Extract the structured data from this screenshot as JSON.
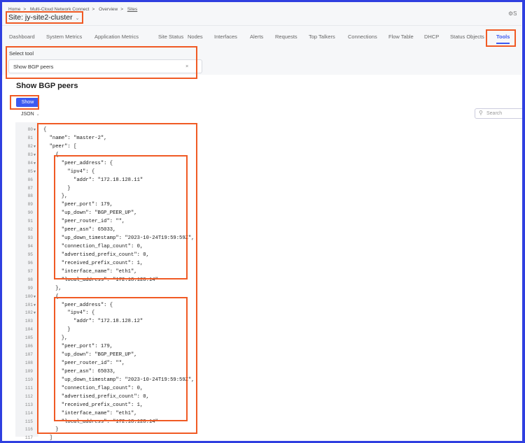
{
  "breadcrumb": [
    "Home",
    "Multi-Cloud Network Connect",
    "Overview",
    "Sites"
  ],
  "site_title": "Site: jy-site2-cluster",
  "header_right": "S",
  "tabs": [
    "Dashboard",
    "System Metrics",
    "Application Metrics",
    "Site Status",
    "Nodes",
    "Interfaces",
    "Alerts",
    "Requests",
    "Top Talkers",
    "Connections",
    "Flow Table",
    "DHCP",
    "Status Objects",
    "Tools"
  ],
  "active_tab": "Tools",
  "select_tool": {
    "label": "Select tool",
    "value": "Show BGP peers"
  },
  "section_title": "Show BGP peers",
  "show_button": "Show",
  "format_select": "JSON",
  "search_placeholder": "Search",
  "colors": {
    "accent": "#3d5af1",
    "highlight": "#f05a24",
    "frame": "#2f3fe0"
  },
  "code_lines": [
    {
      "n": 80,
      "fold": true,
      "i": 0,
      "t": "{"
    },
    {
      "n": 81,
      "i": 1,
      "t": "\"name\": \"master-2\","
    },
    {
      "n": 82,
      "fold": true,
      "i": 1,
      "t": "\"peer\": ["
    },
    {
      "n": 83,
      "fold": true,
      "i": 2,
      "t": "{"
    },
    {
      "n": 84,
      "fold": true,
      "i": 3,
      "t": "\"peer_address\": {"
    },
    {
      "n": 85,
      "fold": true,
      "i": 4,
      "t": "\"ipv4\": {"
    },
    {
      "n": 86,
      "i": 5,
      "t": "\"addr\": \"172.18.128.11\""
    },
    {
      "n": 87,
      "i": 4,
      "t": "}"
    },
    {
      "n": 88,
      "i": 3,
      "t": "},"
    },
    {
      "n": 89,
      "i": 3,
      "t": "\"peer_port\": 179,"
    },
    {
      "n": 90,
      "i": 3,
      "t": "\"up_down\": \"BGP_PEER_UP\","
    },
    {
      "n": 91,
      "i": 3,
      "t": "\"peer_router_id\": \"\","
    },
    {
      "n": 92,
      "i": 3,
      "t": "\"peer_asn\": 65033,"
    },
    {
      "n": 93,
      "i": 3,
      "t": "\"up_down_timestamp\": \"2023-10-24T19:59:59Z\","
    },
    {
      "n": 94,
      "i": 3,
      "t": "\"connection_flap_count\": 0,"
    },
    {
      "n": 95,
      "i": 3,
      "t": "\"advertised_prefix_count\": 0,"
    },
    {
      "n": 96,
      "i": 3,
      "t": "\"received_prefix_count\": 1,"
    },
    {
      "n": 97,
      "i": 3,
      "t": "\"interface_name\": \"eth1\","
    },
    {
      "n": 98,
      "i": 3,
      "t": "\"local_address\": \"172.18.128.14\""
    },
    {
      "n": 99,
      "i": 2,
      "t": "},"
    },
    {
      "n": 100,
      "fold": true,
      "i": 2,
      "t": "{"
    },
    {
      "n": 101,
      "fold": true,
      "i": 3,
      "t": "\"peer_address\": {"
    },
    {
      "n": 102,
      "fold": true,
      "i": 4,
      "t": "\"ipv4\": {"
    },
    {
      "n": 103,
      "i": 5,
      "t": "\"addr\": \"172.18.128.12\""
    },
    {
      "n": 104,
      "i": 4,
      "t": "}"
    },
    {
      "n": 105,
      "i": 3,
      "t": "},"
    },
    {
      "n": 106,
      "i": 3,
      "t": "\"peer_port\": 179,"
    },
    {
      "n": 107,
      "i": 3,
      "t": "\"up_down\": \"BGP_PEER_UP\","
    },
    {
      "n": 108,
      "i": 3,
      "t": "\"peer_router_id\": \"\","
    },
    {
      "n": 109,
      "i": 3,
      "t": "\"peer_asn\": 65033,"
    },
    {
      "n": 110,
      "i": 3,
      "t": "\"up_down_timestamp\": \"2023-10-24T19:59:59Z\","
    },
    {
      "n": 111,
      "i": 3,
      "t": "\"connection_flap_count\": 0,"
    },
    {
      "n": 112,
      "i": 3,
      "t": "\"advertised_prefix_count\": 0,"
    },
    {
      "n": 113,
      "i": 3,
      "t": "\"received_prefix_count\": 1,"
    },
    {
      "n": 114,
      "i": 3,
      "t": "\"interface_name\": \"eth1\","
    },
    {
      "n": 115,
      "i": 3,
      "t": "\"local_address\": \"172.18.128.14\""
    },
    {
      "n": 116,
      "i": 2,
      "t": "}"
    },
    {
      "n": 117,
      "i": 1,
      "t": "]"
    }
  ]
}
